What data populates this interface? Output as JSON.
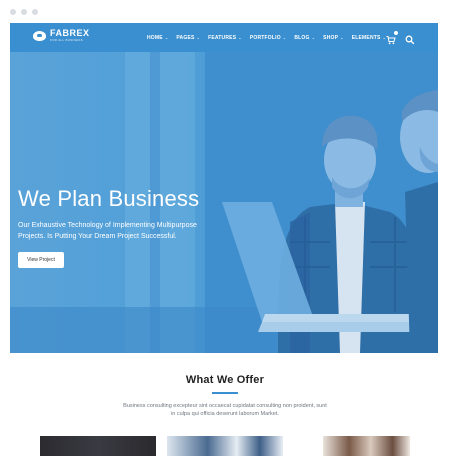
{
  "brand": {
    "name": "FABREX",
    "tagline": "FOR ALL BUSINESS"
  },
  "nav": {
    "items": [
      {
        "label": "HOME"
      },
      {
        "label": "PAGES"
      },
      {
        "label": "FEATURES"
      },
      {
        "label": "PORTFOLIO"
      },
      {
        "label": "BLOG"
      },
      {
        "label": "SHOP"
      },
      {
        "label": "ELEMENTS"
      }
    ],
    "cart_icon": "cart-icon",
    "search_icon": "search-icon"
  },
  "hero": {
    "title": "We Plan Business",
    "text_line1": "Our Exhaustive Technology of Implementing Multipurpose",
    "text_line2": "Projects. Is Putting Your Dream Project Successful.",
    "button": "View Project"
  },
  "offer": {
    "title": "What We Offer",
    "text_line1": "Business consulting excepteur sint occaecat cupidatat consulting non proident, sunt",
    "text_line2": "in culpa qui officia deserunt laborum Market."
  },
  "colors": {
    "accent": "#3a8fd0",
    "text_dark": "#222222",
    "text_muted": "#6e7680"
  }
}
